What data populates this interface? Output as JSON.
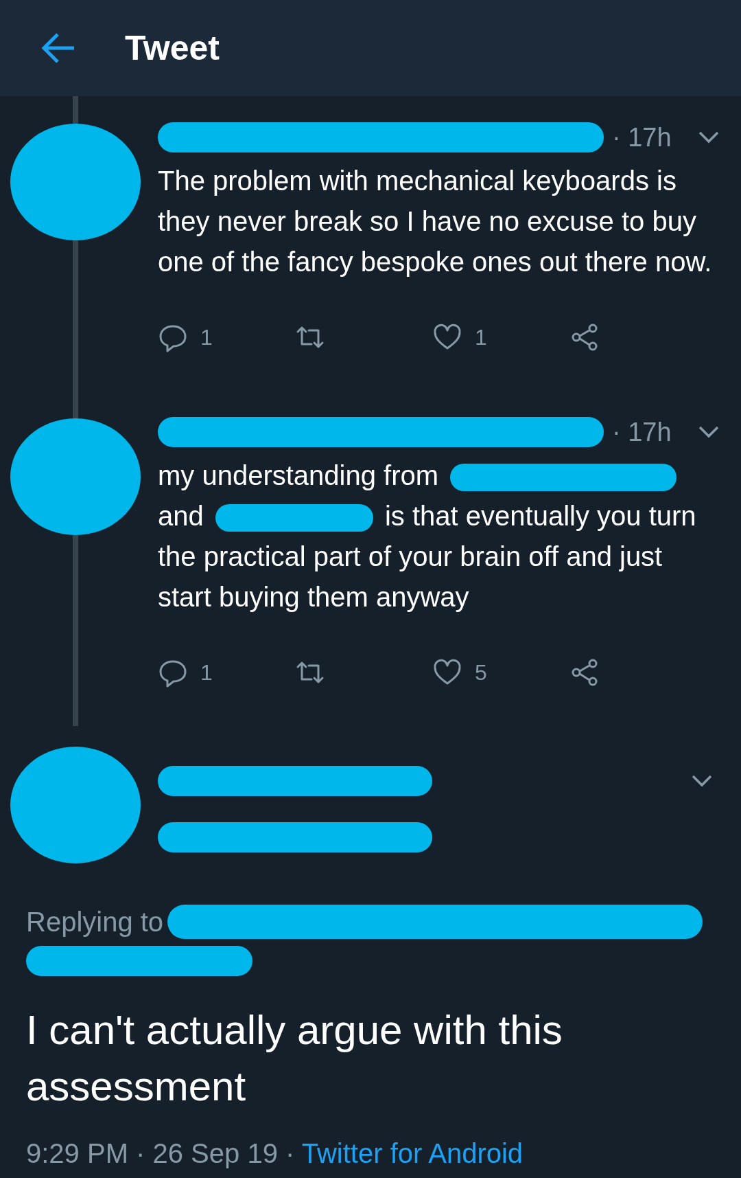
{
  "header": {
    "title": "Tweet"
  },
  "tweets": [
    {
      "kind": "full",
      "time": "· 17h",
      "segments": [
        {
          "kind": "text",
          "text": "The problem with mechanical keyboards is they never break so I have no excuse to buy one of the fancy bespoke ones out there now."
        }
      ],
      "actions": [
        {
          "kind": "reply",
          "count": "1"
        },
        {
          "kind": "retweet"
        },
        {
          "kind": "like",
          "count": "1"
        },
        {
          "kind": "share"
        }
      ]
    },
    {
      "kind": "full",
      "time": "· 17h",
      "segments": [
        {
          "kind": "text",
          "text": "my understanding from"
        },
        {
          "kind": "redaction"
        },
        {
          "kind": "text",
          "text": "and"
        },
        {
          "kind": "redaction"
        },
        {
          "kind": "text",
          "text": "is that eventually you turn the practical part of your brain off and just start buying them anyway"
        }
      ],
      "actions": [
        {
          "kind": "reply",
          "count": "1"
        },
        {
          "kind": "retweet"
        },
        {
          "kind": "like",
          "count": "5"
        },
        {
          "kind": "share"
        }
      ]
    },
    {
      "kind": "collapsed"
    }
  ],
  "main": {
    "replying_label": "Replying to",
    "text": "I can't actually argue with this assessment",
    "time": "9:29 PM · 26 Sep 19 · ",
    "source": "Twitter for Android"
  }
}
